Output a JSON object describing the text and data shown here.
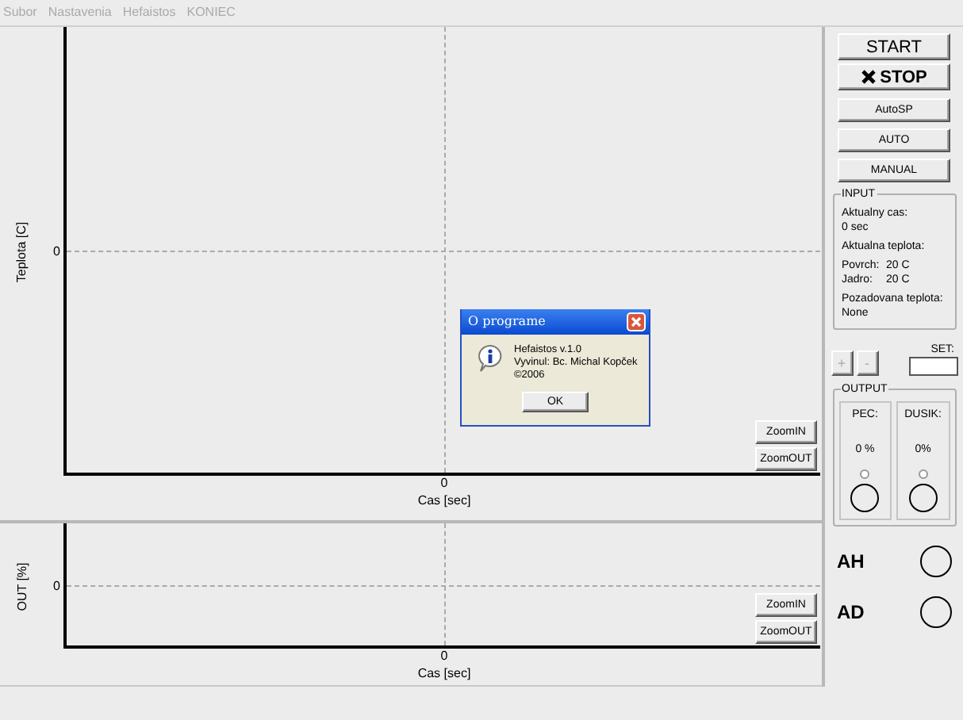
{
  "menu": [
    {
      "label": "Subor",
      "disabled": true
    },
    {
      "label": "Nastavenia",
      "disabled": true
    },
    {
      "label": "Hefaistos",
      "disabled": true
    },
    {
      "label": "KONIEC",
      "disabled": true
    }
  ],
  "charts": [
    {
      "ylabel": "Teplota [C]",
      "ytick": "0",
      "xtick": "0",
      "xlabel": "Cas [sec]",
      "buttons": [
        "ZoomIN",
        "ZoomOUT"
      ]
    },
    {
      "ylabel": "OUT [%]",
      "ytick": "0",
      "xtick": "0",
      "xlabel": "Cas [sec]",
      "buttons": [
        "ZoomIN",
        "ZoomOUT"
      ]
    }
  ],
  "controls": {
    "buttons": [
      {
        "label": "START",
        "kind": "large"
      },
      {
        "label": "STOP",
        "kind": "stop"
      },
      {
        "label": "AutoSP",
        "kind": "small"
      },
      {
        "label": "AUTO",
        "kind": "small"
      },
      {
        "label": "MANUAL",
        "kind": "small"
      }
    ],
    "input": {
      "title": "INPUT",
      "time_label": "Aktualny cas:",
      "time_value": "0 sec",
      "temp_label": "Aktualna teplota:",
      "readings": [
        {
          "label": "Povrch:",
          "value": "20 C"
        },
        {
          "label": "Jadro:",
          "value": "20 C"
        }
      ],
      "setpoint_label": "Pozadovana teplota:",
      "setpoint_value": "None"
    },
    "adjust": [
      {
        "label": "+",
        "disabled": true
      },
      {
        "label": "-",
        "disabled": true
      }
    ],
    "set": {
      "label": "SET:"
    },
    "output": {
      "title": "OUTPUT",
      "channels": [
        {
          "label": "PEC:",
          "value": "0 %",
          "checked": false,
          "on": false
        },
        {
          "label": "DUSIK:",
          "value": "0%",
          "checked": false,
          "on": false
        }
      ]
    },
    "indicators": [
      {
        "label": "AH",
        "on": false
      },
      {
        "label": "AD",
        "on": false
      }
    ]
  },
  "dialog": {
    "title": "O programe",
    "lines": [
      "Hefaistos v.1.0",
      "Vyvinul: Bc. Michal Kopček",
      "©2006"
    ],
    "button": "OK"
  }
}
